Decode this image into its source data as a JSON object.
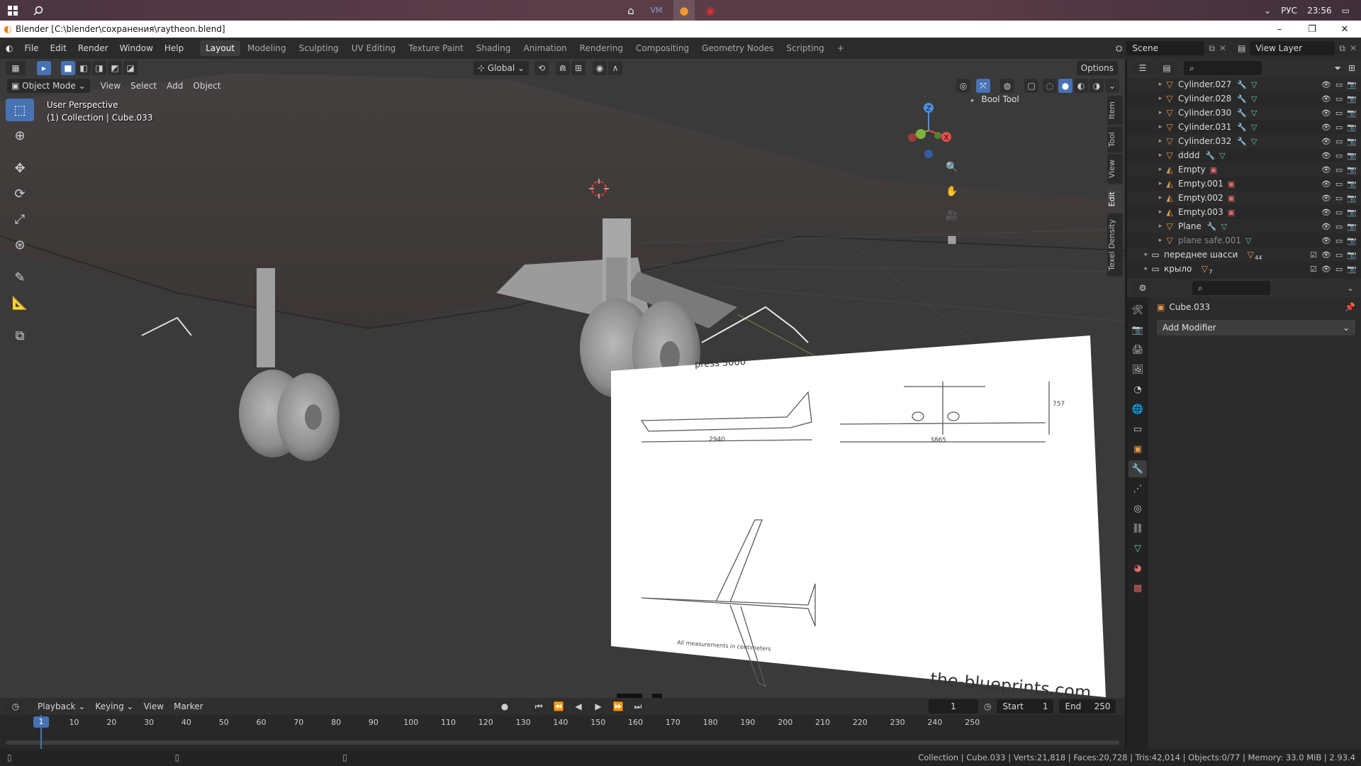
{
  "taskbar": {
    "right": {
      "lang": "РУС",
      "time": "23:56"
    }
  },
  "window": {
    "title": "Blender [C:\\blender\\сохранения\\raytheon.blend]",
    "controls": [
      "–",
      "❐",
      "✕"
    ]
  },
  "topbar": {
    "menus": [
      "File",
      "Edit",
      "Render",
      "Window",
      "Help"
    ],
    "workspaces": [
      {
        "label": "Layout",
        "active": true
      },
      {
        "label": "Modeling"
      },
      {
        "label": "Sculpting"
      },
      {
        "label": "UV Editing"
      },
      {
        "label": "Texture Paint"
      },
      {
        "label": "Shading"
      },
      {
        "label": "Animation"
      },
      {
        "label": "Rendering"
      },
      {
        "label": "Compositing"
      },
      {
        "label": "Geometry Nodes"
      },
      {
        "label": "Scripting"
      }
    ],
    "add_tab": "+",
    "scene": "Scene",
    "view_layer": "View Layer"
  },
  "viewport": {
    "orientation": "Global",
    "options": "Options",
    "mode": "Object Mode",
    "menus": [
      "View",
      "Select",
      "Add",
      "Object"
    ],
    "info_line1": "User Perspective",
    "info_line2": "(1) Collection | Cube.033",
    "bool_tool": "Bool Tool",
    "side_tabs": [
      "Item",
      "Tool",
      "View",
      "Edit",
      "Texel Density"
    ],
    "blueprint": {
      "title": "press 5000",
      "dim_left": "2940",
      "dim_right": "3865",
      "dim_height": "757",
      "scale_note": "All measurements in centimeters",
      "watermark": "the-blueprints.com"
    }
  },
  "outliner": {
    "rows": [
      {
        "name": "Cylinder.027",
        "kind": "mesh",
        "mod": true
      },
      {
        "name": "Cylinder.028",
        "kind": "mesh",
        "mod": true
      },
      {
        "name": "Cylinder.030",
        "kind": "mesh",
        "mod": true
      },
      {
        "name": "Cylinder.031",
        "kind": "mesh",
        "mod": true
      },
      {
        "name": "Cylinder.032",
        "kind": "mesh",
        "mod": true
      },
      {
        "name": "dddd",
        "kind": "mesh",
        "mod": true
      },
      {
        "name": "Empty",
        "kind": "empty"
      },
      {
        "name": "Empty.001",
        "kind": "empty"
      },
      {
        "name": "Empty.002",
        "kind": "empty"
      },
      {
        "name": "Empty.003",
        "kind": "empty"
      },
      {
        "name": "Plane",
        "kind": "mesh",
        "mod": true
      },
      {
        "name": "plane safe.001",
        "kind": "mesh",
        "dim": true
      },
      {
        "name": "переднее шасси",
        "kind": "collection",
        "count": "44"
      },
      {
        "name": "крыло",
        "kind": "collection",
        "count": "7"
      }
    ]
  },
  "properties": {
    "object_name": "Cube.033",
    "add_modifier": "Add Modifier"
  },
  "timeline": {
    "menus": [
      "Playback",
      "Keying",
      "View",
      "Marker"
    ],
    "current_frame": "1",
    "start_label": "Start",
    "start": "1",
    "end_label": "End",
    "end": "250",
    "ticks": [
      "10",
      "20",
      "30",
      "40",
      "50",
      "60",
      "70",
      "80",
      "90",
      "100",
      "110",
      "120",
      "130",
      "140",
      "150",
      "160",
      "170",
      "180",
      "190",
      "200",
      "210",
      "220",
      "230",
      "240",
      "250"
    ],
    "playhead": "1"
  },
  "status": {
    "text": "Collection | Cube.033 | Verts:21,818 | Faces:20,728 | Tris:42,014 | Objects:0/77 | Memory: 33.0 MiB | 2.93.4"
  }
}
